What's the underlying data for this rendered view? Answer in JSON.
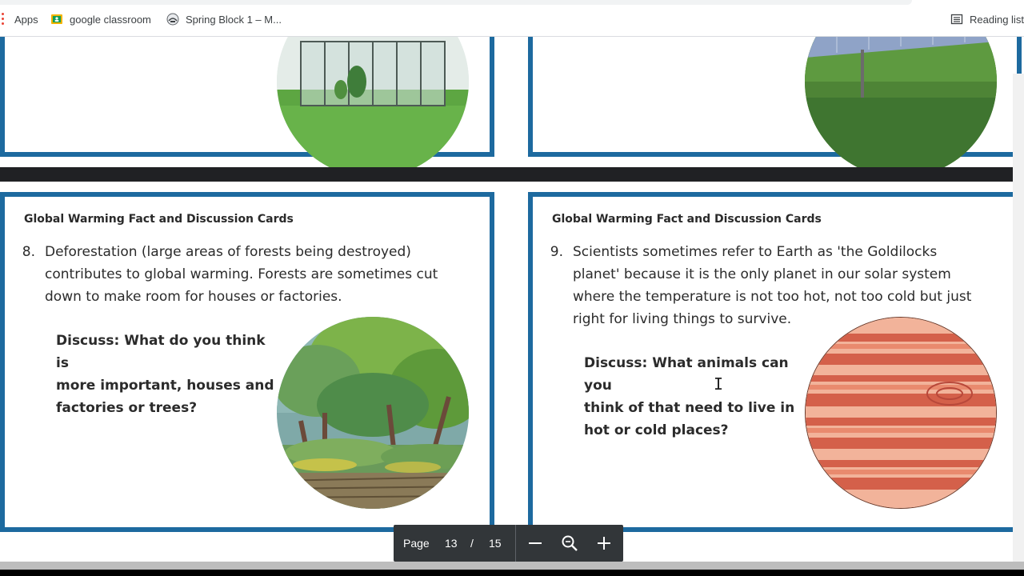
{
  "bookmarks": {
    "apps_label": "Apps",
    "items": [
      {
        "label": "google classroom",
        "icon": "google-classroom-icon"
      },
      {
        "label": "Spring Block 1 – M...",
        "icon": "site-favicon-icon"
      }
    ],
    "reading_list_label": "Reading list"
  },
  "cards": [
    {
      "title": "Global Warming Fact and Discussion Cards",
      "number": "8.",
      "fact_lines": [
        "Deforestation (large areas of forests being destroyed)",
        "contributes to global warming. Forests are sometimes cut",
        "down to make room for houses or factories."
      ],
      "discuss_lines": [
        "Discuss: What do you think is",
        "more important, houses and",
        "factories or trees?"
      ]
    },
    {
      "title": "Global Warming Fact and Discussion Cards",
      "number": "9.",
      "fact_lines": [
        "Scientists sometimes refer to Earth as 'the Goldilocks",
        "planet' because it is the only planet in our solar system",
        "where the temperature is not too hot, not too cold but just",
        "right for living things to survive."
      ],
      "discuss_lines": [
        "Discuss: What animals can you",
        "think of that need to live in",
        "hot or cold places?"
      ]
    }
  ],
  "toolbar": {
    "page_label": "Page",
    "current_page": "13",
    "separator": "/",
    "total_pages": "15"
  },
  "colors": {
    "card_border": "#1d6a9f",
    "toolbar_bg": "#323639",
    "page_separator": "#202124"
  }
}
